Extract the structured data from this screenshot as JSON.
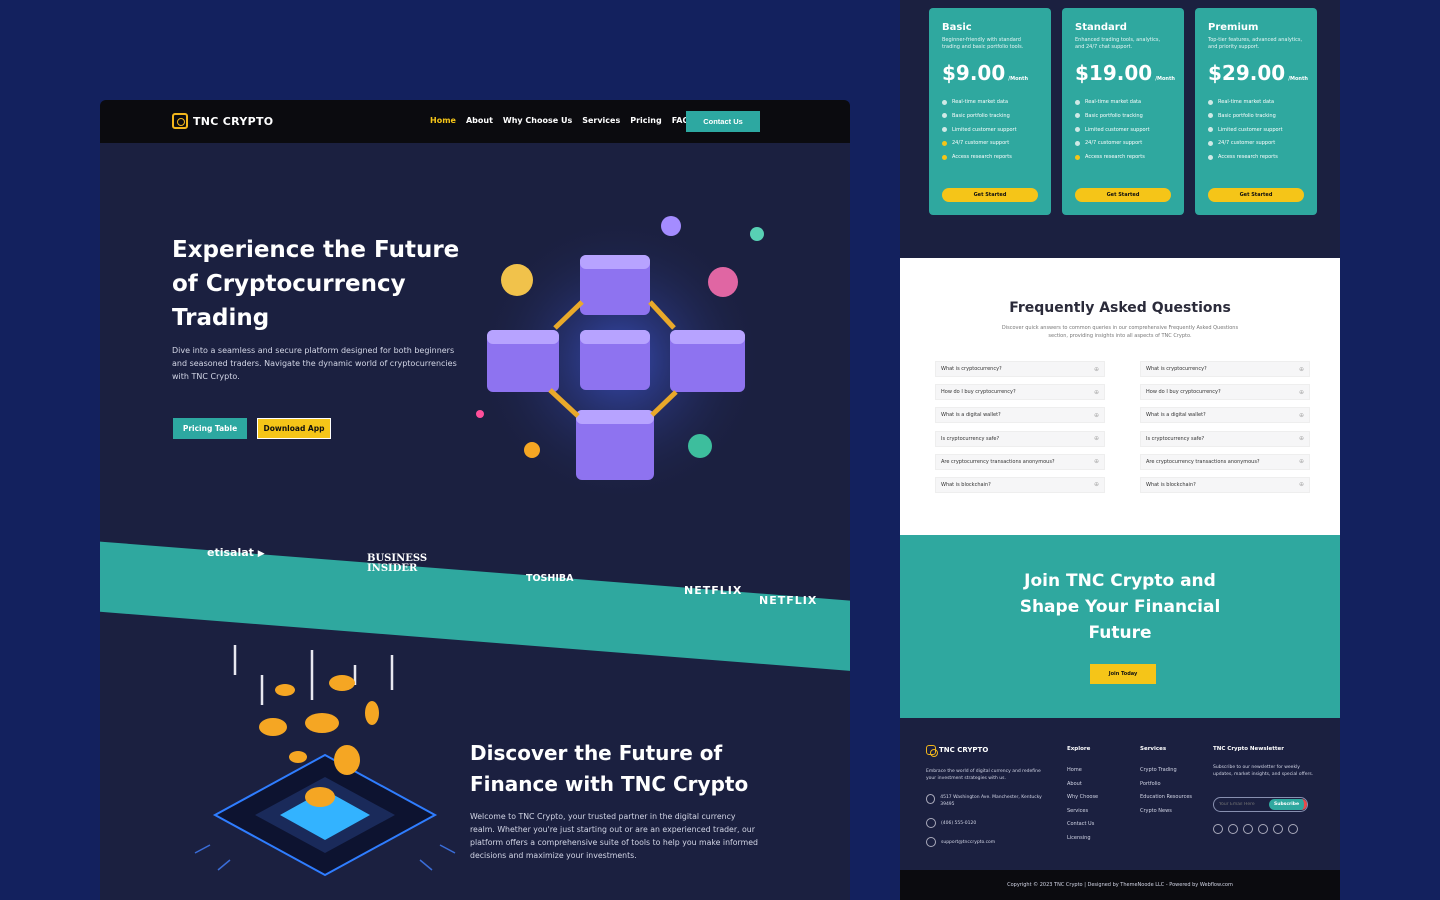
{
  "nav": {
    "brand": "TNC CRYPTO",
    "links": [
      "Home",
      "About",
      "Why Choose Us",
      "Services",
      "Pricing",
      "FAQ"
    ],
    "active_link": "Home",
    "contact_label": "Contact Us"
  },
  "hero": {
    "title": "Experience the Future of Cryptocurrency Trading",
    "text": "Dive into a seamless and secure platform designed for both beginners and seasoned traders. Navigate the dynamic world of cryptocurrencies with TNC Crypto.",
    "pricing_button": "Pricing Table",
    "download_button": "Download App"
  },
  "brands": {
    "etisalat": "etisalat",
    "business_insider_1": "BUSINESS",
    "business_insider_2": "INSIDER",
    "toshiba": "TOSHIBA",
    "netflix_a": "NETFLIX",
    "netflix_b": "NETFLIX"
  },
  "discover": {
    "title": "Discover the Future of Finance with TNC Crypto",
    "text": "Welcome to TNC Crypto, your trusted partner in the digital currency realm. Whether you're just starting out or are an experienced trader, our platform offers a comprehensive suite of tools to help you make informed decisions and maximize your investments."
  },
  "pricing": {
    "plans": [
      {
        "name": "Basic",
        "desc": "Beginner-friendly with standard trading and basic portfolio tools.",
        "price": "$9.00",
        "period": "/Month",
        "button": "Get Started"
      },
      {
        "name": "Standard",
        "desc": "Enhanced trading tools, analytics, and 24/7 chat support.",
        "price": "$19.00",
        "period": "/Month",
        "button": "Get Started"
      },
      {
        "name": "Premium",
        "desc": "Top-tier features, advanced analytics, and priority support.",
        "price": "$29.00",
        "period": "/Month",
        "button": "Get Started"
      }
    ],
    "features": [
      "Real-time market data",
      "Basic portfolio tracking",
      "Limited customer support",
      "24/7 customer support",
      "Access research reports"
    ]
  },
  "faq": {
    "title": "Frequently Asked Questions",
    "subtitle": "Discover quick answers to common queries in our comprehensive Frequently Asked Questions section, providing insights into all aspects of TNC Crypto.",
    "questions": [
      "What is cryptocurrency?",
      "How do I buy cryptocurrency?",
      "What is a digital wallet?",
      "Is cryptocurrency safe?",
      "Are cryptocurrency transactions anonymous?",
      "What is blockchain?"
    ]
  },
  "cta": {
    "title": "Join TNC Crypto and Shape Your Financial Future",
    "button": "Join Today"
  },
  "footer": {
    "brand": "TNC CRYPTO",
    "tagline": "Embrace the world of digital currency and redefine your investment strategies with us.",
    "address": "4517 Washington Ave. Manchester, Kentucky 39495",
    "phone": "(406) 555-0120",
    "email": "support@tnccrypto.com",
    "explore_title": "Explore",
    "explore": [
      "Home",
      "About",
      "Why Choose",
      "Services",
      "Contact Us",
      "Licensing"
    ],
    "services_title": "Services",
    "services": [
      "Crypto Trading",
      "Portfolio",
      "Education Resources",
      "Crypto News"
    ],
    "newsletter_title": "TNC Crypto Newsletter",
    "newsletter_text": "Subscribe to our newsletter for weekly updates, market insights, and special offers.",
    "email_placeholder": "Your Email Here",
    "subscribe_label": "Subscribe",
    "copyright": "Copyright © 2023 TNC Crypto | Designed by ThemeNoode LLC - Powered by Webflow.com"
  },
  "colors": {
    "background": "#13215e",
    "panel": "#1b2040",
    "teal": "#2fa89f",
    "yellow": "#f5c518",
    "nav": "#0b0b0f"
  }
}
